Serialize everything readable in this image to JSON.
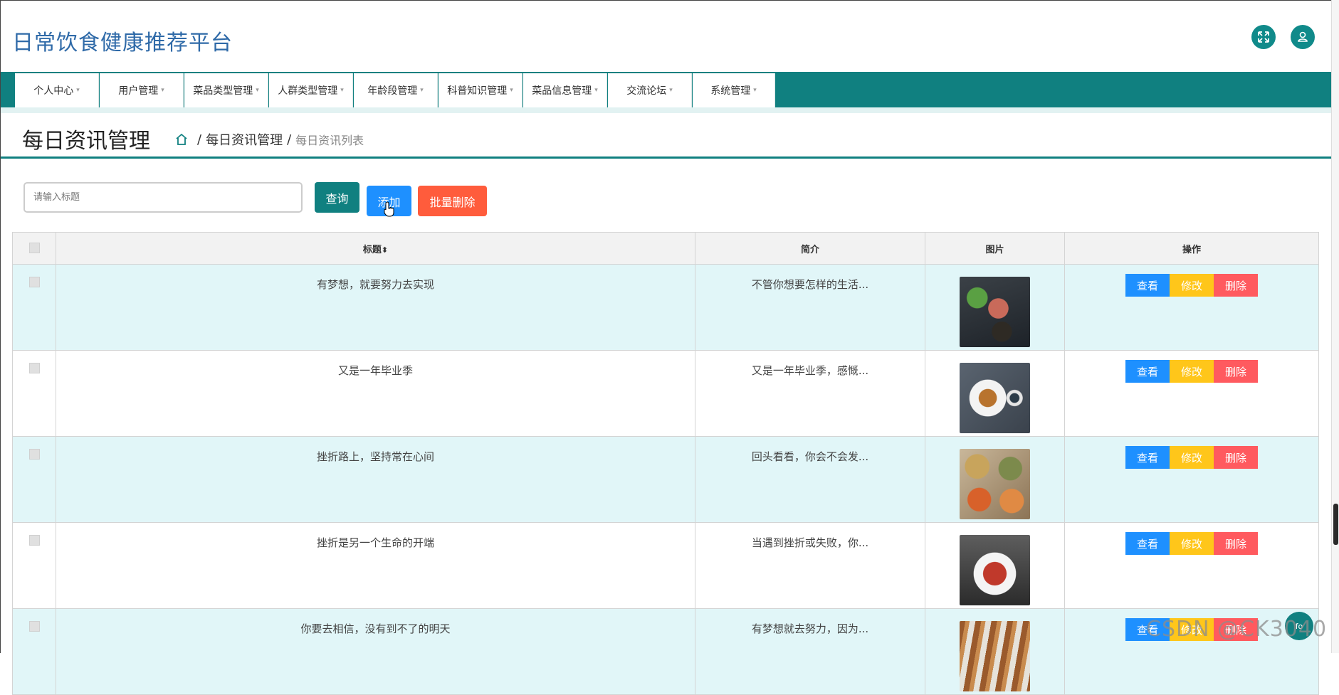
{
  "header": {
    "title": "日常饮食健康推荐平台",
    "fullscreen_icon": "expand-icon",
    "user_icon": "user-icon"
  },
  "nav": {
    "items": [
      {
        "label": "个人中心"
      },
      {
        "label": "用户管理"
      },
      {
        "label": "菜品类型管理"
      },
      {
        "label": "人群类型管理"
      },
      {
        "label": "年龄段管理"
      },
      {
        "label": "科普知识管理"
      },
      {
        "label": "菜品信息管理"
      },
      {
        "label": "交流论坛"
      },
      {
        "label": "系统管理"
      }
    ],
    "caret": "▾"
  },
  "page": {
    "title": "每日资讯管理",
    "breadcrumb": {
      "sep": "/",
      "level1": "每日资讯管理",
      "level2": "每日资讯列表"
    }
  },
  "toolbar": {
    "search_placeholder": "请输入标题",
    "query_label": "查询",
    "add_label": "添加",
    "batch_delete_label": "批量删除"
  },
  "table": {
    "columns": {
      "title": "标题",
      "sort_icon": "⬍",
      "summary": "简介",
      "image": "图片",
      "actions": "操作"
    },
    "action_labels": {
      "view": "查看",
      "edit": "修改",
      "delete": "删除"
    },
    "rows": [
      {
        "title": "有梦想，就要努力去实现",
        "summary": "不管你想要怎样的生活...",
        "image": "food-photo-1"
      },
      {
        "title": "又是一年毕业季",
        "summary": "又是一年毕业季，感慨...",
        "image": "food-photo-2"
      },
      {
        "title": "挫折路上，坚持常在心间",
        "summary": "回头看看，你会不会发...",
        "image": "food-photo-3"
      },
      {
        "title": "挫折是另一个生命的开端",
        "summary": "当遇到挫折或失败，你...",
        "image": "food-photo-4"
      },
      {
        "title": "你要去相信，没有到不了的明天",
        "summary": "有梦想就去努力，因为...",
        "image": "food-photo-5"
      }
    ]
  },
  "float_button": {
    "label": "fo"
  },
  "watermark": "CSDN @CK3040",
  "colors": {
    "primary": "#108080",
    "view": "#1e90ff",
    "edit": "#ffc61a",
    "delete": "#ff5a5f",
    "batch": "#ff5c3c",
    "row_alt": "#e1f6f8"
  }
}
